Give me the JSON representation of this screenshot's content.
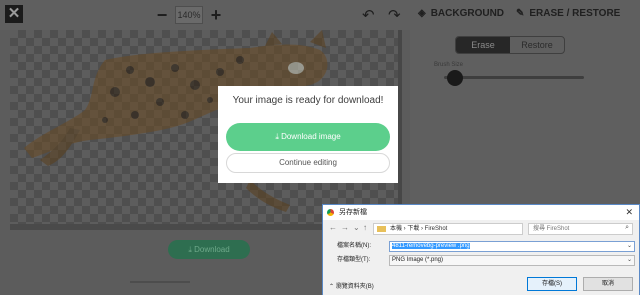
{
  "toolbar": {
    "close_icon": "close-icon",
    "zoom_minus": "−",
    "zoom_level": "140%",
    "zoom_plus": "+",
    "undo_glyph": "↶",
    "redo_glyph": "↷",
    "background_tab": "BACKGROUND",
    "erase_restore_tab": "ERASE / RESTORE"
  },
  "panel": {
    "erase_label": "Erase",
    "restore_label": "Restore",
    "brush_size_label": "Brush Size",
    "brush_size_fraction": 0.08
  },
  "popup": {
    "title": "Your image is ready for download!",
    "download_label": "Download image",
    "continue_label": "Continue editing"
  },
  "bottom": {
    "download_label": "Download"
  },
  "dialog": {
    "title": "另存新檔",
    "close_glyph": "✕",
    "path": "本機 › 下載 › FireShot",
    "search_placeholder": "搜尋 FireShot",
    "filename_label": "檔案名稱(N):",
    "filename_value": "4811-removebg-preview .png",
    "filetype_label": "存檔類型(T):",
    "filetype_value": "PNG Image (*.png)",
    "hide_folders_label": "瀏覽資料夾(B)",
    "save_label": "存檔(S)",
    "cancel_label": "取消"
  },
  "colors": {
    "accent_green": "#5ccf8c",
    "dialog_border": "#5a89c6"
  }
}
